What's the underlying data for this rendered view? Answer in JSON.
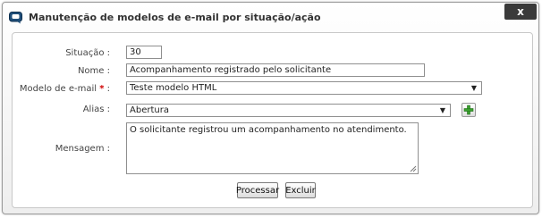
{
  "dialog": {
    "title": "Manutenção de modelos de e-mail por situação/ação",
    "close_label": "x"
  },
  "form": {
    "situacao": {
      "label": "Situação :",
      "value": "30"
    },
    "nome": {
      "label": "Nome :",
      "value": "Acompanhamento registrado pelo solicitante"
    },
    "modelo": {
      "label": "Modelo de e-mail",
      "required_marker": "*",
      "colon": ":",
      "value": "Teste modelo HTML",
      "arrow": "▼"
    },
    "alias": {
      "label": "Alias :",
      "value": "Abertura",
      "arrow": "▼",
      "add_icon": "plus-icon"
    },
    "mensagem": {
      "label": "Mensagem :",
      "value": "O solicitante registrou um acompanhamento no atendimento."
    }
  },
  "actions": {
    "processar_label": "Processar",
    "excluir_label": "Excluir"
  },
  "colors": {
    "close_bg": "#3a3a3a",
    "required": "#d00000",
    "add_icon": "#3aa02e"
  }
}
